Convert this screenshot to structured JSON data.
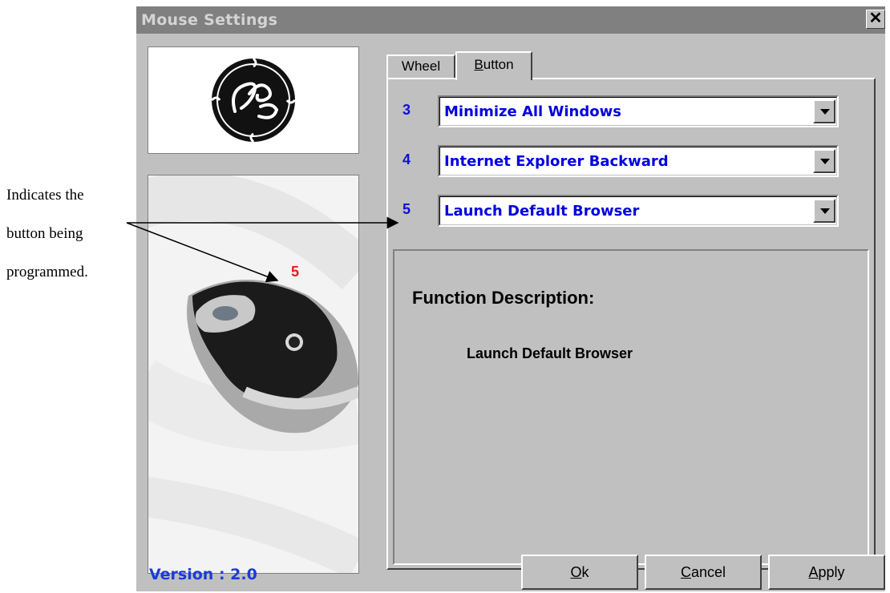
{
  "annotation": {
    "lines": [
      "Indicates the",
      "button being",
      "programmed."
    ]
  },
  "window": {
    "title": "Mouse Settings",
    "close_glyph": "✕"
  },
  "mouse_image": {
    "highlighted_button": "5"
  },
  "tabs": [
    {
      "label": "Wheel",
      "underline_index": -1,
      "selected": false
    },
    {
      "label": "Button",
      "underline_index": 0,
      "selected": true
    }
  ],
  "button_rows": [
    {
      "number": "3",
      "selected_action": "Minimize All Windows"
    },
    {
      "number": "4",
      "selected_action": "Internet Explorer Backward"
    },
    {
      "number": "5",
      "selected_action": "Launch Default Browser"
    }
  ],
  "function_description": {
    "heading": "Function Description:",
    "text": "Launch Default Browser"
  },
  "footer": {
    "version": "Version : 2.0",
    "buttons": {
      "ok": {
        "first": "O",
        "rest": "k"
      },
      "cancel": {
        "first": "C",
        "rest": "ancel"
      },
      "apply": {
        "first": "A",
        "rest": "pply"
      }
    }
  },
  "colors": {
    "dialog_bg": "#c0c0c0",
    "title_bar": "#808080",
    "combo_text": "#0000e0",
    "row_number": "#1010d0",
    "version_text": "#1a3cd8",
    "mouse_number": "#e02020"
  },
  "icons": {
    "logo": "ge-logo",
    "close": "close-icon",
    "dropdown": "chevron-down-icon"
  }
}
